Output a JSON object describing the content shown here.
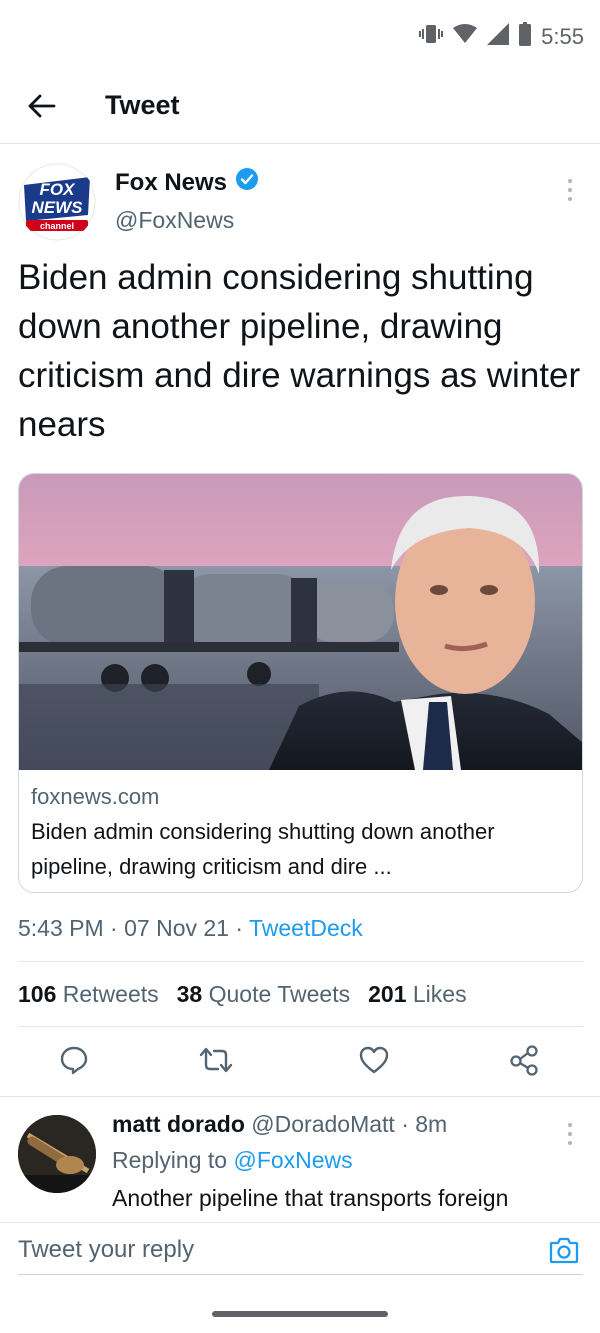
{
  "status_bar": {
    "time": "5:55"
  },
  "header": {
    "title": "Tweet"
  },
  "tweet": {
    "author_name": "Fox News",
    "author_handle": "@FoxNews",
    "avatar_lines": [
      "FOX",
      "NEWS",
      "channel"
    ],
    "text": "Biden admin considering shutting down another pipeline, drawing criticism and dire warnings as winter nears",
    "card": {
      "domain": "foxnews.com",
      "title": "Biden admin considering shutting down another pipeline, drawing criticism and dire ..."
    },
    "time": "5:43 PM",
    "date": "07 Nov 21",
    "source": "TweetDeck",
    "stats": {
      "retweets_count": "106",
      "retweets_label": "Retweets",
      "quote_count": "38",
      "quote_label": "Quote Tweets",
      "likes_count": "201",
      "likes_label": "Likes"
    }
  },
  "reply": {
    "author_name": "matt dorado",
    "author_handle": "@DoradoMatt",
    "time_ago": "8m",
    "replying_to_label": "Replying to",
    "replying_to_handle": "@FoxNews",
    "text": "Another pipeline that transports foreign"
  },
  "composer": {
    "placeholder": "Tweet your reply"
  },
  "colors": {
    "accent": "#1d9bf0",
    "secondary_text": "#536471",
    "fox_blue": "#1a3a8a",
    "fox_red": "#d0021b"
  },
  "icons": [
    "vibrate-icon",
    "wifi-icon",
    "signal-icon",
    "battery-icon",
    "back-arrow-icon",
    "verified-badge-icon",
    "more-vertical-icon",
    "reply-icon",
    "retweet-icon",
    "like-icon",
    "share-icon",
    "camera-icon"
  ]
}
